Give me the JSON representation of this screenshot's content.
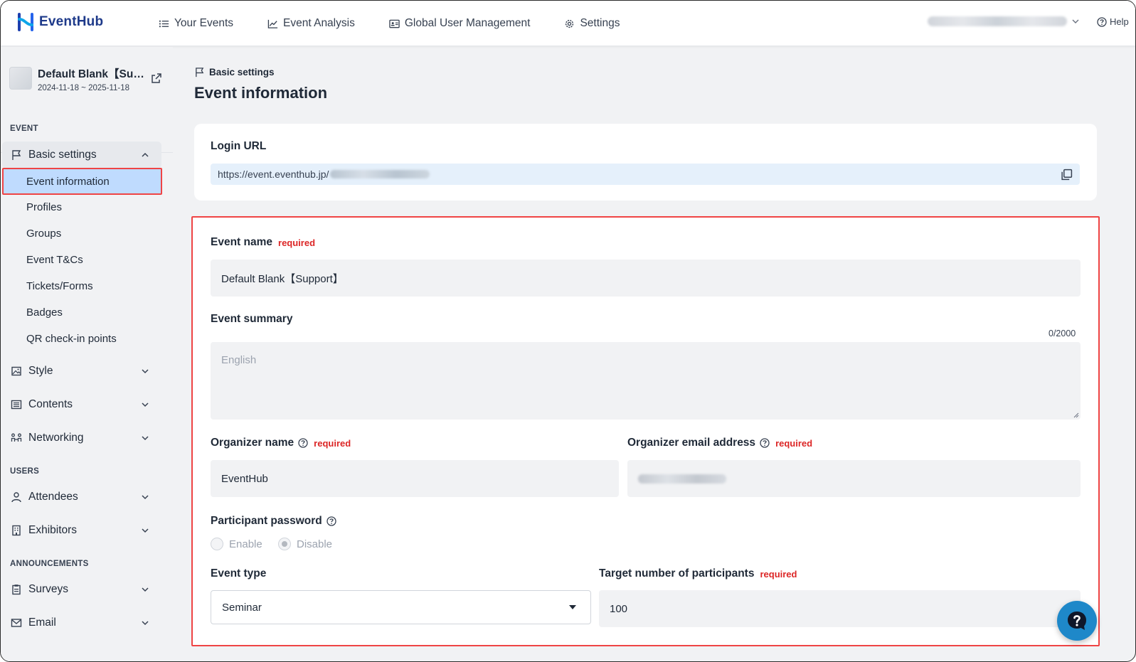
{
  "app": {
    "name": "EventHub"
  },
  "nav": {
    "items": [
      {
        "label": "Your Events",
        "icon": "list-icon"
      },
      {
        "label": "Event Analysis",
        "icon": "chart-line-icon"
      },
      {
        "label": "Global User Management",
        "icon": "id-card-icon"
      },
      {
        "label": "Settings",
        "icon": "gear-icon"
      }
    ],
    "help_label": "Help"
  },
  "event": {
    "title": "Default Blank【Su…",
    "dates": "2024-11-18 ~ 2025-11-18"
  },
  "sidebar": {
    "sections": {
      "event": "EVENT",
      "users": "USERS",
      "announcements": "ANNOUNCEMENTS"
    },
    "basic_settings": "Basic settings",
    "children": [
      "Event information",
      "Profiles",
      "Groups",
      "Event T&Cs",
      "Tickets/Forms",
      "Badges",
      "QR check-in points"
    ],
    "style": "Style",
    "contents": "Contents",
    "networking": "Networking",
    "attendees": "Attendees",
    "exhibitors": "Exhibitors",
    "surveys": "Surveys",
    "email": "Email"
  },
  "main": {
    "breadcrumb": "Basic settings",
    "title": "Event information",
    "login_url": {
      "label": "Login URL",
      "value": "https://event.eventhub.jp/"
    },
    "form": {
      "required_label": "required",
      "event_name": {
        "label": "Event name",
        "value": "Default Blank【Support】"
      },
      "event_summary": {
        "label": "Event summary",
        "counter": "0/2000",
        "placeholder": "English"
      },
      "organizer_name": {
        "label": "Organizer name",
        "value": "EventHub"
      },
      "organizer_email": {
        "label": "Organizer email address"
      },
      "participant_password": {
        "label": "Participant password",
        "options": [
          "Enable",
          "Disable"
        ],
        "selected": "Disable"
      },
      "event_type": {
        "label": "Event type",
        "value": "Seminar"
      },
      "target_participants": {
        "label": "Target number of participants",
        "value": "100"
      }
    }
  },
  "colors": {
    "brand": "#1e3a8a",
    "active_item_bg": "#bfdbfe",
    "highlight_border": "#ef4444",
    "required": "#dc2626",
    "help_button": "#1e88c9"
  }
}
